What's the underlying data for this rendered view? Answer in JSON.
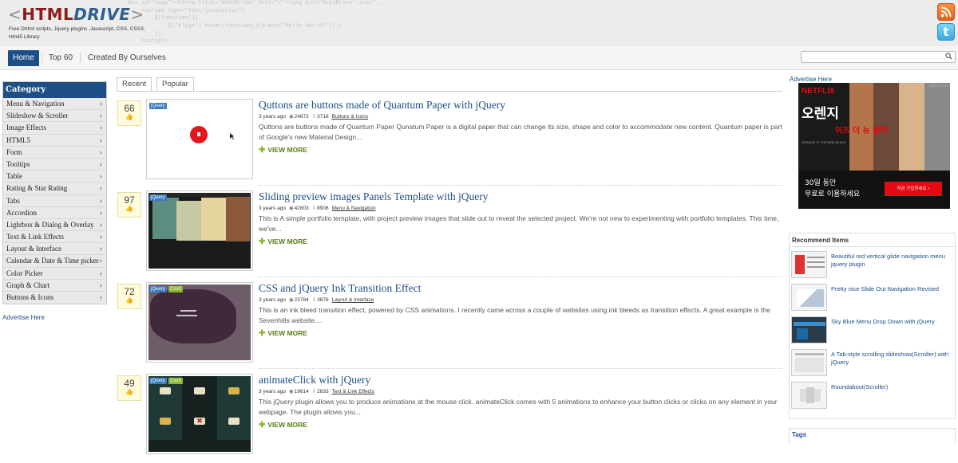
{
  "header": {
    "logo_open": "<",
    "logo_html": "HTML",
    "logo_drive": "DRIVE",
    "logo_close": ">",
    "tagline": "Free Dhtml scripts, Jquery plugins ,Javascript, CSS, CSS3, Html5 Library",
    "code_bg": "div id=\"logo\"><h1><a title=\"HtmlDrive\" href=\"/\"><img alt=\"HtmlDrive\" src=\"...\n    <script type=\"text/javascript\">\n        $(function(){\n            $(\"#logo\").hover(function(){alert(\"Hello World!\")});\n        });\n    <script>",
    "rss_icon": "rss-icon",
    "twitter_icon": "twitter-icon"
  },
  "nav": {
    "items": [
      "Home",
      "Top 60",
      "Created By Ourselves"
    ],
    "active": "Home",
    "search_value": ""
  },
  "sidebar": {
    "title": "Category",
    "items": [
      "Menu & Navigation",
      "Slideshow & Scroller",
      "Image Effects",
      "HTML5",
      "Form",
      "Tooltips",
      "Table",
      "Rating & Star Rating",
      "Tabs",
      "Accordion",
      "Lightbox & Dialog & Overlay",
      "Text & Link Effects",
      "Layout & Interface",
      "Calendar & Date & Time picker",
      "Color Picker",
      "Graph & Chart",
      "Buttons & Icons"
    ],
    "advertise": "Advertise Here"
  },
  "tabs": [
    "Recent",
    "Popular"
  ],
  "items": [
    {
      "score": "66",
      "badges": [
        "jQuery"
      ],
      "title": "Quttons are buttons made of Quantum Paper with jQuery",
      "age": "3 years ago",
      "views": "24872",
      "downloads": "3718",
      "category": "Buttons & Icons",
      "desc": "Quttons are buttons made of Quantum Paper Qunatum Paper is a digital paper that can change its size, shape and color to accommodate new content. Quantum paper is part of Google's new Material Design...",
      "more": "VIEW MORE"
    },
    {
      "score": "97",
      "badges": [
        "jQuery"
      ],
      "title": "Sliding preview images Panels Template with jQuery",
      "age": "3 years ago",
      "views": "42803",
      "downloads": "8906",
      "category": "Menu & Navigation",
      "desc": "This is A simple portfolio template, with project preview images that slide out to reveal the selected project. We're not new to experimenting with portfolio templates. This time, we've...",
      "more": "VIEW MORE"
    },
    {
      "score": "72",
      "badges": [
        "jQuery",
        "Css3"
      ],
      "title": "CSS and jQuery Ink Transition Effect",
      "age": "3 years ago",
      "views": "23784",
      "downloads": "3876",
      "category": "Layout & Interface",
      "desc": "This is an ink bleed transition effect, powered by CSS animations. I recently came across a couple of websites using ink bleeds as transition effects. A great example is the Sevenhills website....",
      "more": "VIEW MORE"
    },
    {
      "score": "49",
      "badges": [
        "jQuery",
        "Css3"
      ],
      "title": "animateClick with jQuery",
      "age": "3 years ago",
      "views": "19614",
      "downloads": "2833",
      "category": "Text & Link Effects",
      "desc": "This jQuery plugin allows you to produce animations at the mouse click. animateClick comes with 5 animations to enhance your button clicks or clicks on any element in your webpage. The plugin allows you...",
      "more": "VIEW MORE"
    }
  ],
  "right": {
    "advertise": "Advertise Here",
    "ad": {
      "brand": "NETFLIX",
      "title_main": "오렌지",
      "title_sub": "이즈 더 뉴 블랙",
      "small": "ORANGE IS THE NEW BLACK",
      "line1": "30일 동안",
      "line2": "무료로 이용하세요",
      "cta": "지금 가입하세요 ›",
      "info": "AdChoices"
    },
    "recommend_title": "Recommend Items",
    "recommend": [
      "Beautiful red vertical glide navigation menu jquery plugin",
      "Pretty nice Slide Out Navigation Revised",
      "Sky Blue Menu Drop Down with jQuery",
      "A Tab-style scrolling slideshow(Scroller) with jQuery",
      "Roundabout(Scroller)"
    ],
    "tags_title": "Tags"
  }
}
